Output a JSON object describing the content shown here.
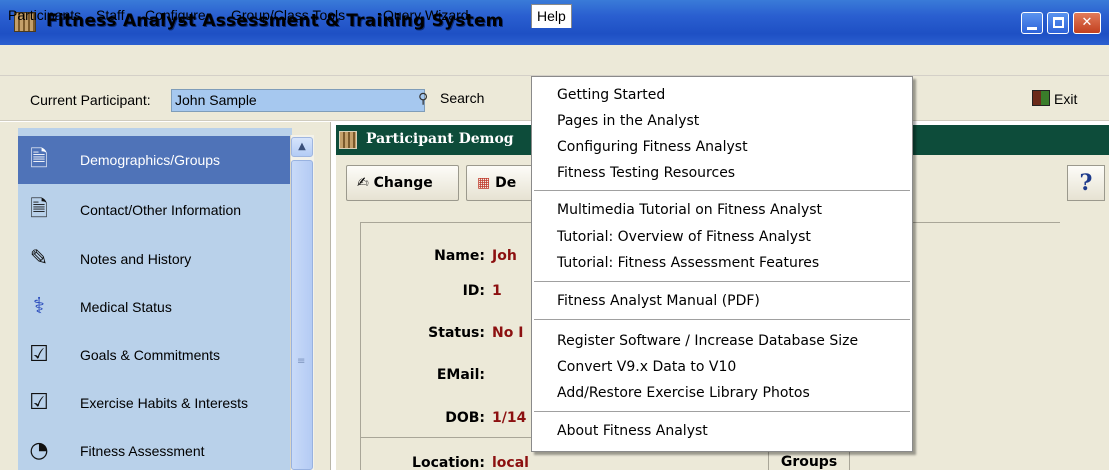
{
  "window": {
    "title": "Fitness Analyst Assessment & Training System"
  },
  "menubar": {
    "items": [
      "Participants",
      "Staff",
      "Configure",
      "Group/Class Tools",
      "Query Wizard",
      "Help"
    ]
  },
  "toolbar": {
    "current_label": "Current Participant:",
    "current_value": "John Sample",
    "search_label": "Search",
    "exit_label": "Exit"
  },
  "nav": {
    "items": [
      {
        "label": "Demographics/Groups",
        "icon": "document-icon",
        "selected": true
      },
      {
        "label": "Contact/Other Information",
        "icon": "document-icon"
      },
      {
        "label": "Notes and History",
        "icon": "notepad-pencil-icon"
      },
      {
        "label": "Medical Status",
        "icon": "caduceus-icon"
      },
      {
        "label": "Goals & Commitments",
        "icon": "checklist-icon"
      },
      {
        "label": "Exercise Habits & Interests",
        "icon": "checklist-icon"
      },
      {
        "label": "Fitness Assessment",
        "icon": "tape-measure-icon"
      }
    ]
  },
  "section": {
    "title": "Participant Demog"
  },
  "content_toolbar": {
    "change_label": "Change",
    "d_label": "De"
  },
  "form": {
    "name_label": "Name:",
    "name_value": "Joh",
    "id_label": "ID:",
    "id_value": "1",
    "status_label": "Status:",
    "status_value": "No I",
    "email_label": "EMail:",
    "email_value": "",
    "dob_label": "DOB:",
    "dob_value": "1/14",
    "location_label": "Location:",
    "location_value": "local",
    "groups_label": "Groups"
  },
  "help_menu": {
    "groups": [
      [
        "Getting Started",
        "Pages in the Analyst",
        "Configuring Fitness Analyst",
        "Fitness Testing Resources"
      ],
      [
        "Multimedia Tutorial on Fitness Analyst",
        "Tutorial: Overview of Fitness Analyst",
        "Tutorial: Fitness Assessment Features"
      ],
      [
        "Fitness Analyst Manual (PDF)"
      ],
      [
        "Register Software / Increase Database Size",
        "Convert V9.x Data to V10",
        "Add/Restore Exercise Library Photos"
      ],
      [
        "About Fitness Analyst"
      ]
    ]
  },
  "colors": {
    "titlebar": "#245edb",
    "nav_selected": "#4f73b8",
    "nav_bg": "#b9d1ea",
    "section_header": "#0d4c3a",
    "value_text": "#8c1010"
  }
}
